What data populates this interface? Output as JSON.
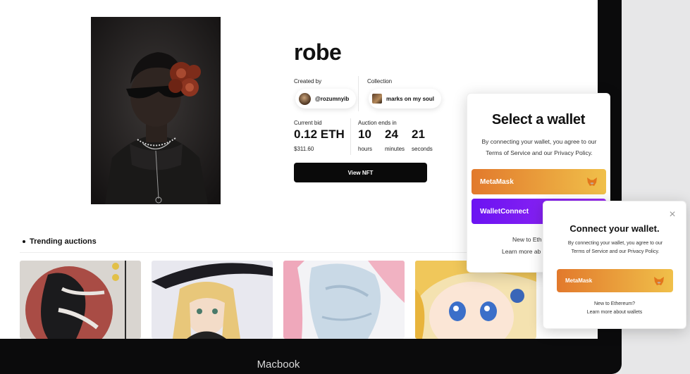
{
  "nft": {
    "title": "robe",
    "created_by_label": "Created by",
    "creator": "@rozumnyib",
    "collection_label": "Collection",
    "collection": "marks on my soul",
    "current_bid_label": "Current bid",
    "current_bid": "0.12 ETH",
    "current_bid_usd": "$311.60",
    "auction_label": "Auction ends in",
    "countdown": [
      {
        "value": "10",
        "unit": "hours"
      },
      {
        "value": "24",
        "unit": "minutes"
      },
      {
        "value": "21",
        "unit": "seconds"
      }
    ],
    "view_button": "View NFT"
  },
  "trending": {
    "heading": "Trending auctions"
  },
  "wallet_modal": {
    "title": "Select a wallet",
    "subtitle_line1": "By connecting your wallet, you agree to our",
    "subtitle_line2": "Terms of Service and our Privacy Policy.",
    "options": [
      {
        "label": "MetaMask",
        "icon": "metamask-fox-icon"
      },
      {
        "label": "WalletConnect",
        "icon": "walletconnect-icon"
      }
    ],
    "footer_partial_1": "New to Eth",
    "footer_partial_2": "Learn more ab"
  },
  "connect_modal": {
    "title": "Connect your wallet.",
    "subtitle_line1": "By connecting your wallet, you agree to our",
    "subtitle_line2": "Terms of Service and our Privacy Policy.",
    "option": "MetaMask",
    "footer_line1": "New to Ethereum?",
    "footer_line2": "Learn more about wallets",
    "close_icon": "close-icon"
  },
  "device_label": "Macbook",
  "colors": {
    "metamask_gradient_start": "#e2792c",
    "metamask_gradient_end": "#f0c04a",
    "walletconnect_start": "#6b13f2",
    "walletconnect_end": "#9b2cf3",
    "button_dark": "#0a0a0a"
  }
}
